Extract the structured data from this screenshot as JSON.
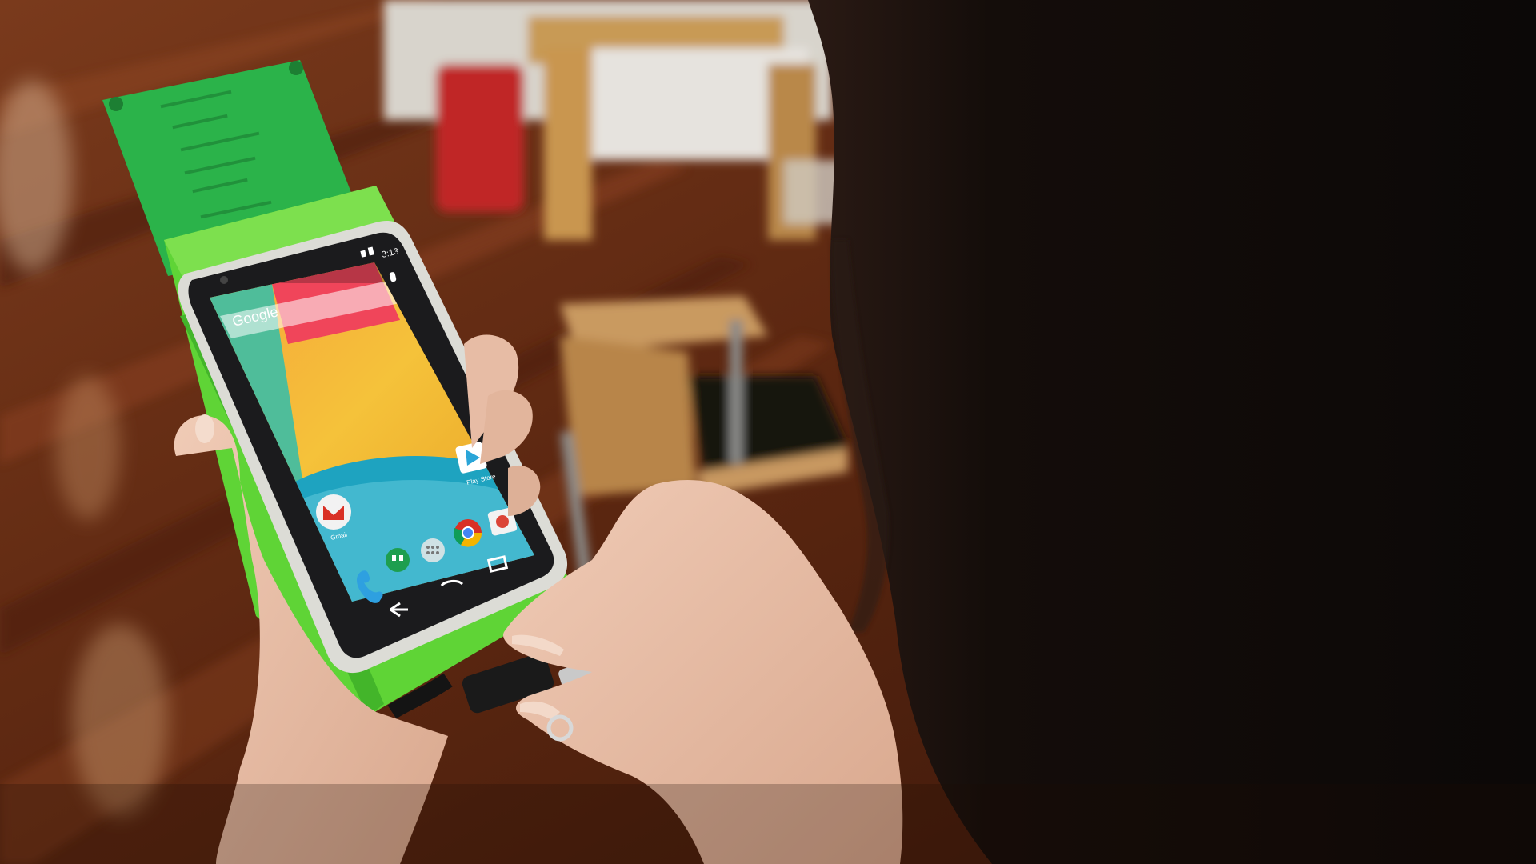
{
  "scene": {
    "subject": "hand holding smartphone in green case while plugging in a micro-USB cable",
    "colors": {
      "floor": "#6a2e14",
      "floor_dark": "#2a1208",
      "case_green": "#5fd436",
      "case_green_dark": "#2ea21c",
      "skin": "#e7bca5",
      "hair": "#140d0a",
      "phone_body": "#1b1b1d",
      "phone_bezel": "#dcdcd6"
    }
  },
  "phone": {
    "status_time": "3:13",
    "search_label": "Google",
    "apps": [
      {
        "name": "Play Store",
        "icon": "play-store-icon"
      },
      {
        "name": "Gmail",
        "icon": "gmail-icon"
      }
    ],
    "dock": [
      {
        "icon": "phone-icon"
      },
      {
        "icon": "hangouts-icon"
      },
      {
        "icon": "app-drawer-icon"
      },
      {
        "icon": "chrome-icon"
      },
      {
        "icon": "camera-icon"
      }
    ],
    "nav": [
      {
        "icon": "back-icon"
      },
      {
        "icon": "home-icon"
      },
      {
        "icon": "recents-icon"
      }
    ]
  }
}
